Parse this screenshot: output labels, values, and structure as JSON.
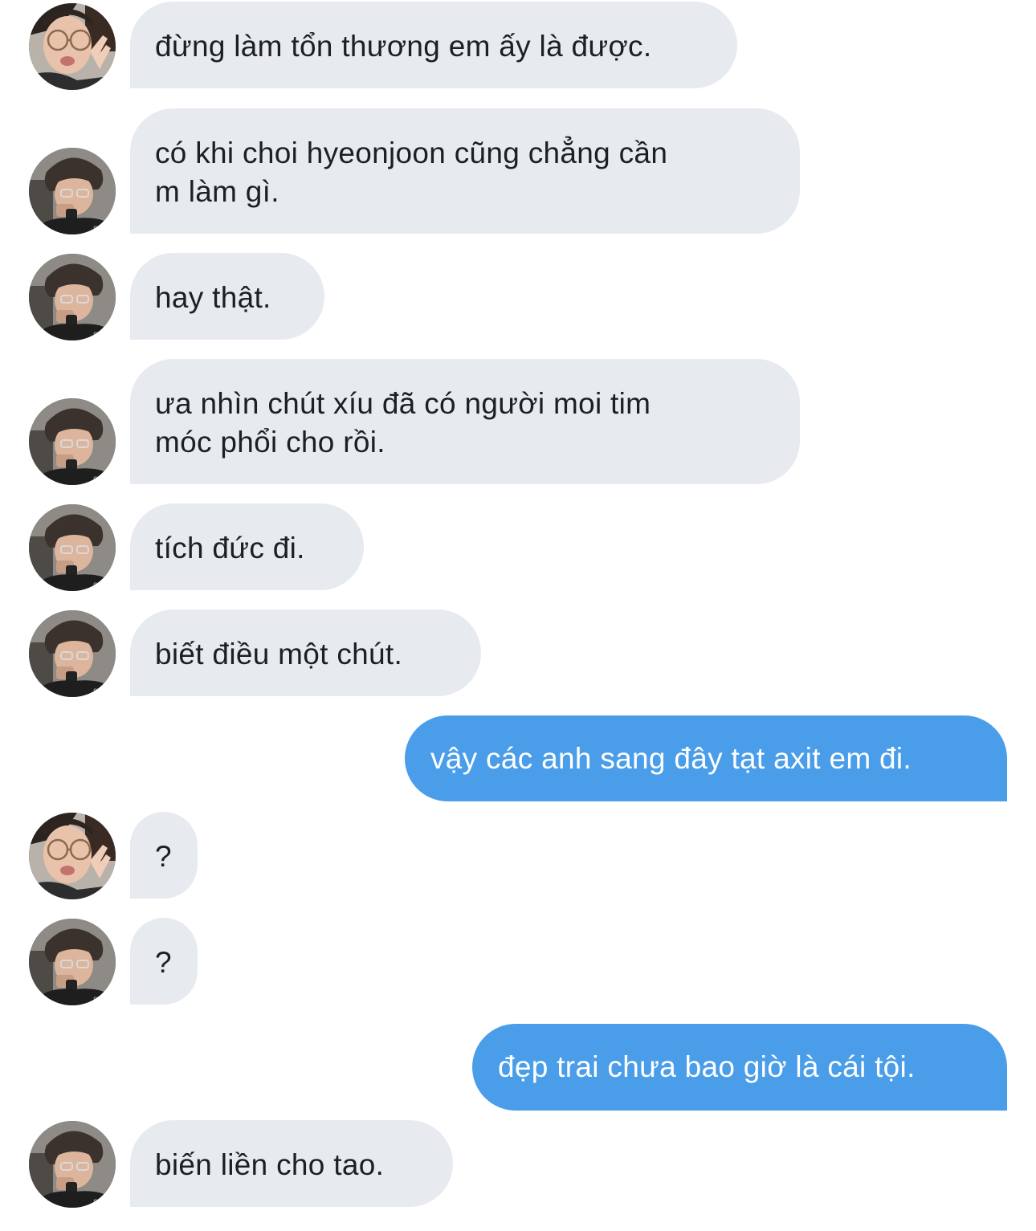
{
  "conversation": {
    "messages": [
      {
        "sender": "contact-a",
        "text": "đừng làm tổn thương em ấy là được."
      },
      {
        "sender": "contact-b",
        "text": "có khi choi hyeonjoon cũng chẳng cần\nm làm gì."
      },
      {
        "sender": "contact-b",
        "text": "hay thật."
      },
      {
        "sender": "contact-b",
        "text": "ưa nhìn chút xíu đã có người moi tim\nmóc phổi cho rồi."
      },
      {
        "sender": "contact-b",
        "text": "tích đức đi."
      },
      {
        "sender": "contact-b",
        "text": "biết điều một chút."
      },
      {
        "sender": "me",
        "text": "vậy các anh sang đây tạt axit em đi."
      },
      {
        "sender": "contact-a",
        "text": "?"
      },
      {
        "sender": "contact-b",
        "text": "?"
      },
      {
        "sender": "me",
        "text": "đẹp trai chưa bao giờ là cái tội."
      },
      {
        "sender": "contact-b",
        "text": "biến liền cho tao."
      }
    ]
  },
  "colors": {
    "incoming_bubble": "#e7eaef",
    "outgoing_bubble": "#4a9de9",
    "incoming_text": "#1c1f23",
    "outgoing_text": "#ffffff"
  }
}
